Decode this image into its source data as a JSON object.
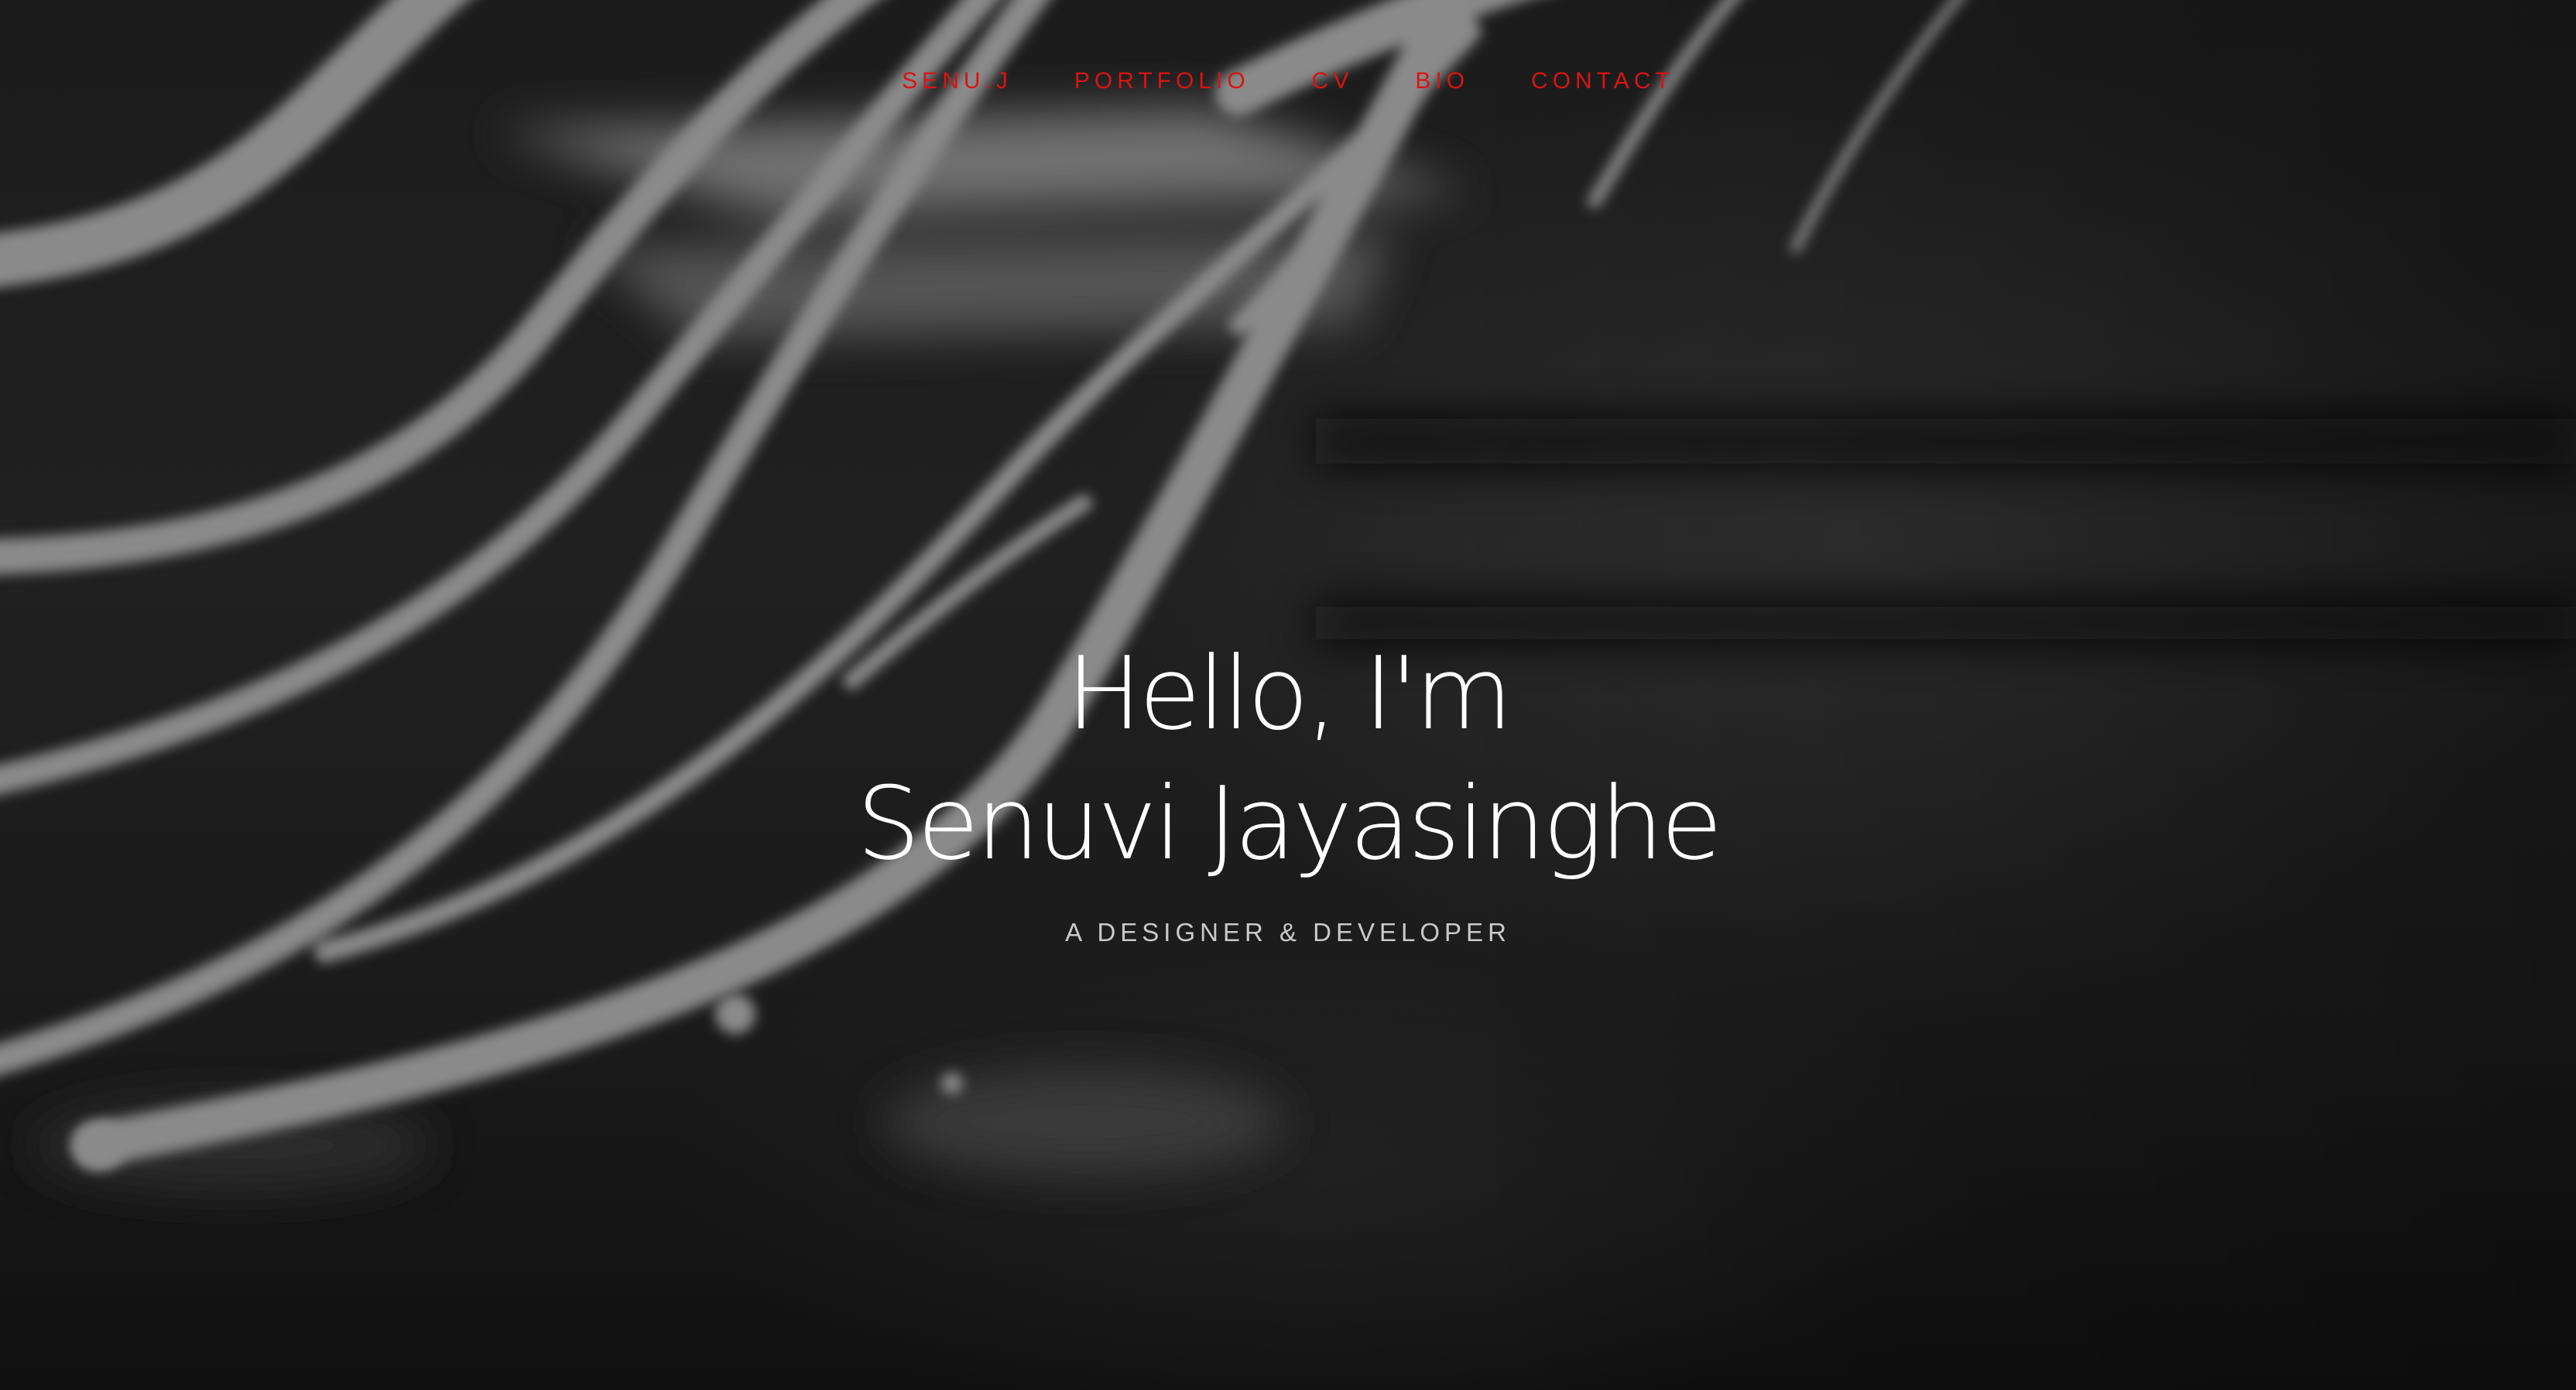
{
  "nav": {
    "items": [
      {
        "label": "SENU.J"
      },
      {
        "label": "PORTFOLIO"
      },
      {
        "label": "CV"
      },
      {
        "label": "BIO"
      },
      {
        "label": "CONTACT"
      }
    ]
  },
  "hero": {
    "greeting": "Hello, I'm",
    "name": "Senuvi Jayasinghe",
    "tagline": "A DESIGNER & DEVELOPER"
  },
  "colors": {
    "nav_link": "#d81414",
    "headline": "#ffffff",
    "tagline": "#c9c9c9",
    "background": "#1c1c1c"
  }
}
